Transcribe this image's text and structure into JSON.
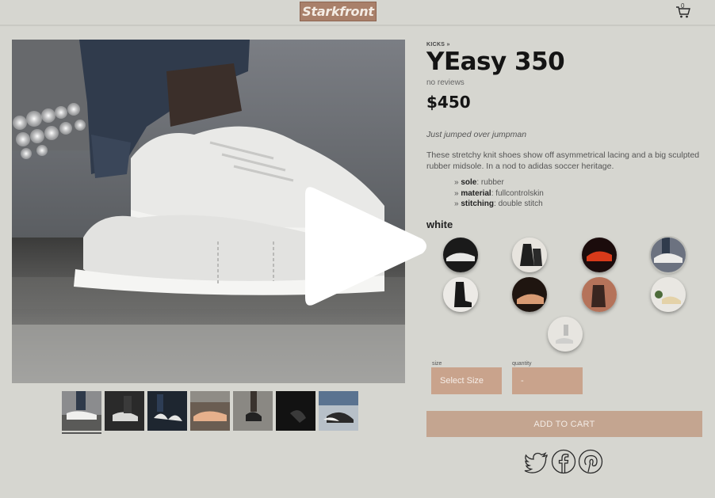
{
  "header": {
    "logo_text": "Starkfront",
    "cart_count": "0",
    "cart_icon": "cart-icon"
  },
  "product": {
    "brand": "KICKS »",
    "title": "YEasy 350",
    "reviews": "no reviews",
    "price": "$450",
    "tagline": "Just jumped over jumpman",
    "description": "These stretchy knit shoes show off asymmetrical lacing and a big sculpted rubber midsole. In a nod to adidas soccer heritage.",
    "specs": [
      {
        "name": "sole",
        "value": "rubber"
      },
      {
        "name": "material",
        "value": "fullcontrolskin"
      },
      {
        "name": "stitching",
        "value": "double stitch"
      }
    ],
    "selected_color": "white",
    "swatch_count": 9,
    "selected_swatch_index": 3,
    "thumbnail_count": 7,
    "selected_thumbnail_index": 0
  },
  "form": {
    "size_label": "size",
    "size_value": "Select Size",
    "quantity_label": "quantity",
    "quantity_value": "-",
    "add_to_cart": "ADD TO CART"
  },
  "social": [
    "twitter-icon",
    "facebook-icon",
    "pinterest-icon"
  ],
  "overlay": {
    "icon": "play-icon"
  },
  "colors": {
    "background": "#d6d6d0",
    "accent": "#c4a590",
    "logo_bg": "#a9806a",
    "text_dark": "#141414"
  }
}
